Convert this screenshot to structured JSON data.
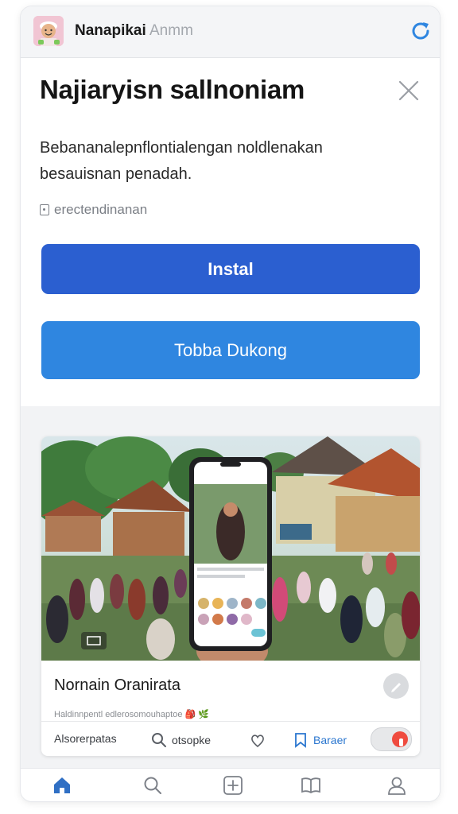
{
  "header": {
    "app_name": "Nanapikai",
    "app_sub": "Anmm",
    "avatar_icon": "avatar-icon",
    "refresh_icon": "refresh-icon"
  },
  "dialog": {
    "title": "Najiaryisn sallnoniam",
    "description": "Bebananalepnflontialengan noldlenakan besauisnan penadah.",
    "meta": "erectendinanan",
    "install_label": "Instal",
    "support_label": "Tobba Dukong",
    "close_icon": "close-icon"
  },
  "post": {
    "title": "Nornain Oranirata",
    "caption": "Haldinnpentl edlerosomouhaptoe 🎒 🌿",
    "actions": {
      "comments": "Alsorerpatas",
      "search": "otsopke",
      "save": "Baraer"
    }
  },
  "nav": {
    "items": [
      "home-icon",
      "search-icon",
      "add-icon",
      "library-icon",
      "profile-icon"
    ]
  },
  "colors": {
    "primary": "#2b5fd0",
    "secondary": "#2f86e0",
    "accent_red": "#ef4b3f",
    "link_blue": "#2a76cf"
  }
}
